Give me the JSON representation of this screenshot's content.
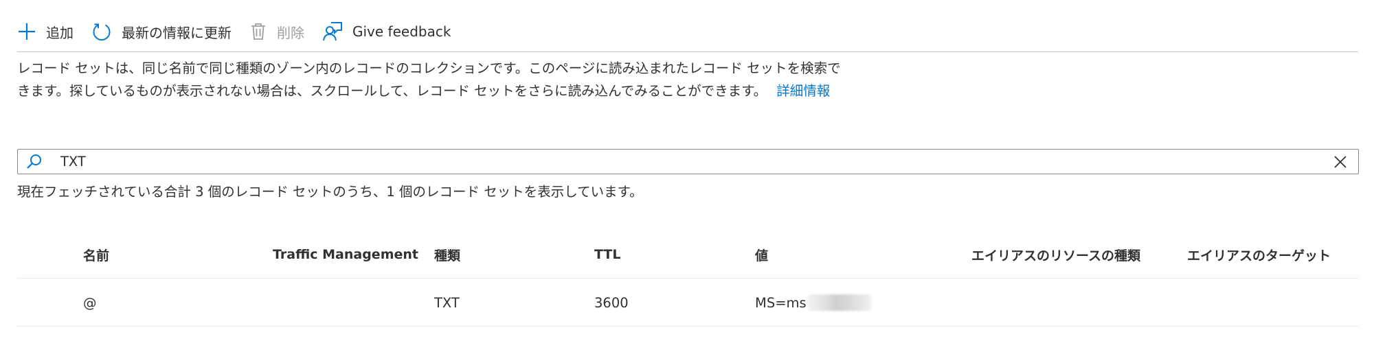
{
  "toolbar": {
    "add_label": "追加",
    "refresh_label": "最新の情報に更新",
    "delete_label": "削除",
    "feedback_label": "Give feedback"
  },
  "description": {
    "text": "レコード セットは、同じ名前で同じ種類のゾーン内のレコードのコレクションです。このページに読み込まれたレコード セットを検索できます。探しているものが表示されない場合は、スクロールして、レコード セットをさらに読み込んでみることができます。",
    "link_label": "詳細情報"
  },
  "search": {
    "value": "TXT",
    "placeholder": ""
  },
  "result_summary": "現在フェッチされている合計 3 個のレコード セットのうち、1 個のレコード セットを表示しています。",
  "table": {
    "columns": [
      "名前",
      "Traffic Management",
      "種類",
      "TTL",
      "値",
      "エイリアスのリソースの種類",
      "エイリアスのターゲット"
    ],
    "rows": [
      {
        "name": "@",
        "traffic_management": "",
        "type": "TXT",
        "ttl": "3600",
        "value": "MS=ms",
        "alias_resource_type": "",
        "alias_target": ""
      }
    ]
  },
  "colors": {
    "accent": "#0078d4",
    "text": "#323130",
    "disabled": "#a19f9d",
    "border": "#8a8886",
    "divider": "#edebe9"
  },
  "icons": {
    "add": "plus-icon",
    "refresh": "refresh-icon",
    "delete": "trash-icon",
    "feedback": "feedback-icon",
    "search": "search-icon",
    "clear": "close-icon"
  }
}
